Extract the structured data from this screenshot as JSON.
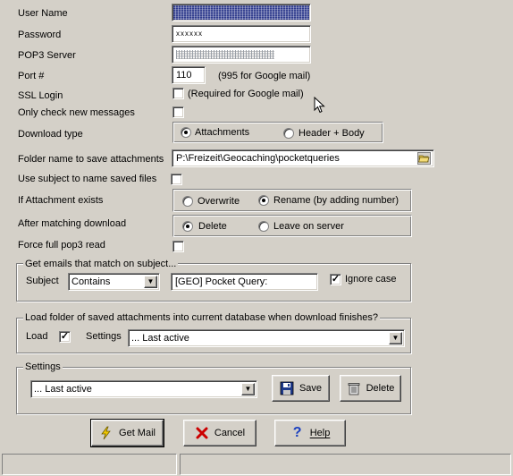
{
  "labels": {
    "user_name": "User Name",
    "password": "Password",
    "pop3_server": "POP3 Server",
    "port": "Port #",
    "ssl_login": "SSL Login",
    "only_check_new": "Only check new messages",
    "download_type": "Download type",
    "folder_name": "Folder name to save attachments",
    "use_subject": "Use subject to name saved files",
    "if_attachment_exists": "If Attachment exists",
    "after_matching_download": "After matching download",
    "force_full_pop3": "Force full pop3 read"
  },
  "fields": {
    "password_value": "xxxxxx",
    "port_value": "110",
    "port_hint": "(995 for Google mail)",
    "ssl_hint": "(Required for Google mail)",
    "folder_value": "P:\\Freizeit\\Geocaching\\pocketqueries"
  },
  "download_type": {
    "attachments": "Attachments",
    "header_body": "Header + Body",
    "selected": "Attachments"
  },
  "if_exists": {
    "overwrite": "Overwrite",
    "rename": "Rename (by adding number)",
    "selected": "Rename (by adding number)"
  },
  "after_download": {
    "delete": "Delete",
    "leave": "Leave on server",
    "selected": "Delete"
  },
  "checkboxes": {
    "ssl_login": false,
    "only_check_new": false,
    "use_subject": false,
    "force_full_pop3": false,
    "ignore_case": true,
    "load": true
  },
  "subject_group": {
    "title": "Get emails that match on subject...",
    "subject_label": "Subject",
    "match_value": "Contains",
    "subject_text": "[GEO] Pocket Query:",
    "ignore_case_label": "Ignore case"
  },
  "load_group": {
    "title": "Load folder of saved attachments into current database when download finishes?",
    "load_label": "Load",
    "settings_label": "Settings",
    "settings_value": "... Last active"
  },
  "settings_group": {
    "title": "Settings",
    "settings_value": "... Last active",
    "save_label": "Save",
    "delete_label": "Delete"
  },
  "buttons": {
    "get_mail": "Get Mail",
    "cancel": "Cancel",
    "help": "Help"
  },
  "icons": {
    "folder": "folder-browse-icon",
    "save": "floppy-disk-icon",
    "delete": "trash-can-icon",
    "get_mail": "lightning-icon",
    "cancel": "red-x-icon",
    "help": "question-mark-icon",
    "cursor": "mouse-pointer-icon"
  },
  "colors": {
    "window_bg": "#d4d0c8",
    "cancel_red": "#cc0000",
    "help_blue": "#1a3fbf",
    "lightning_yellow": "#f0c800"
  }
}
